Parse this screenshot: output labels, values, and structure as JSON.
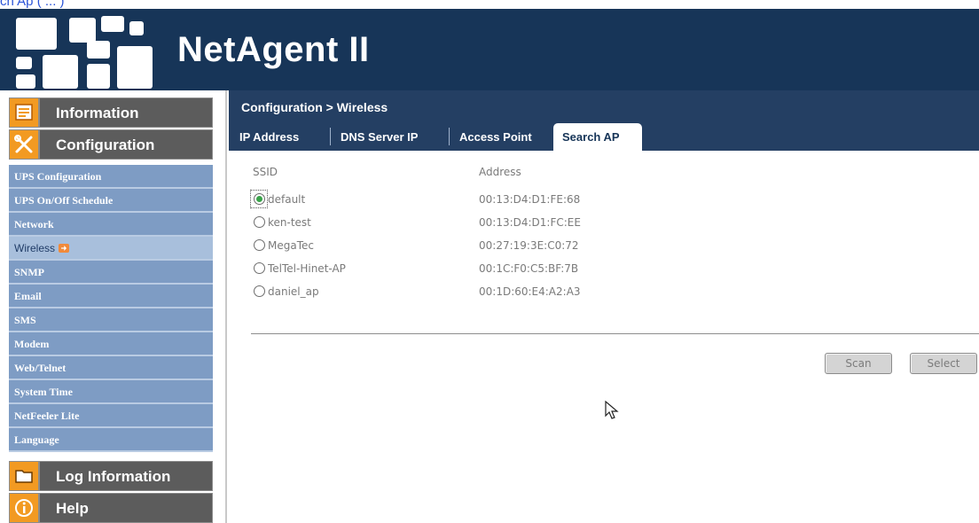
{
  "caption": "ch Ap ( ... )",
  "header": {
    "brand": "NetAgent II",
    "logo_icon": "netagent-logo-icon"
  },
  "sidebar": {
    "information": {
      "label": "Information",
      "icon": "document-icon"
    },
    "configuration": {
      "label": "Configuration",
      "icon": "tools-icon"
    },
    "items": [
      {
        "label": "UPS Configuration"
      },
      {
        "label": "UPS On/Off Schedule"
      },
      {
        "label": "Network"
      },
      {
        "label": "Wireless",
        "active": true,
        "icon": "arrow-right-icon"
      },
      {
        "label": "SNMP"
      },
      {
        "label": "Email"
      },
      {
        "label": "SMS"
      },
      {
        "label": "Modem"
      },
      {
        "label": "Web/Telnet"
      },
      {
        "label": "System Time"
      },
      {
        "label": "NetFeeler Lite"
      },
      {
        "label": "Language"
      }
    ],
    "log": {
      "label": "Log Information",
      "icon": "folder-icon"
    },
    "help": {
      "label": "Help",
      "icon": "info-icon"
    }
  },
  "content": {
    "breadcrumb": "Configuration > Wireless",
    "tabs": [
      {
        "label": "IP Address"
      },
      {
        "label": "DNS Server IP"
      },
      {
        "label": "Access Point"
      },
      {
        "label": "Search AP",
        "active": true
      }
    ],
    "table": {
      "headers": {
        "ssid": "SSID",
        "address": "Address"
      },
      "rows": [
        {
          "ssid": "default",
          "address": "00:13:D4:D1:FE:68",
          "selected": true
        },
        {
          "ssid": "ken-test",
          "address": "00:13:D4:D1:FC:EE",
          "selected": false
        },
        {
          "ssid": "MegaTec",
          "address": "00:27:19:3E:C0:72",
          "selected": false
        },
        {
          "ssid": "TelTel-Hinet-AP",
          "address": "00:1C:F0:C5:BF:7B",
          "selected": false
        },
        {
          "ssid": "daniel_ap",
          "address": "00:1D:60:E4:A2:A3",
          "selected": false
        }
      ]
    },
    "buttons": {
      "scan": "Scan",
      "select": "Select"
    }
  },
  "colors": {
    "header_bg": "#173558",
    "tab_bar_bg": "#243f63",
    "accent_orange": "#f29a22",
    "submenu_bg": "#7e9cc4"
  }
}
